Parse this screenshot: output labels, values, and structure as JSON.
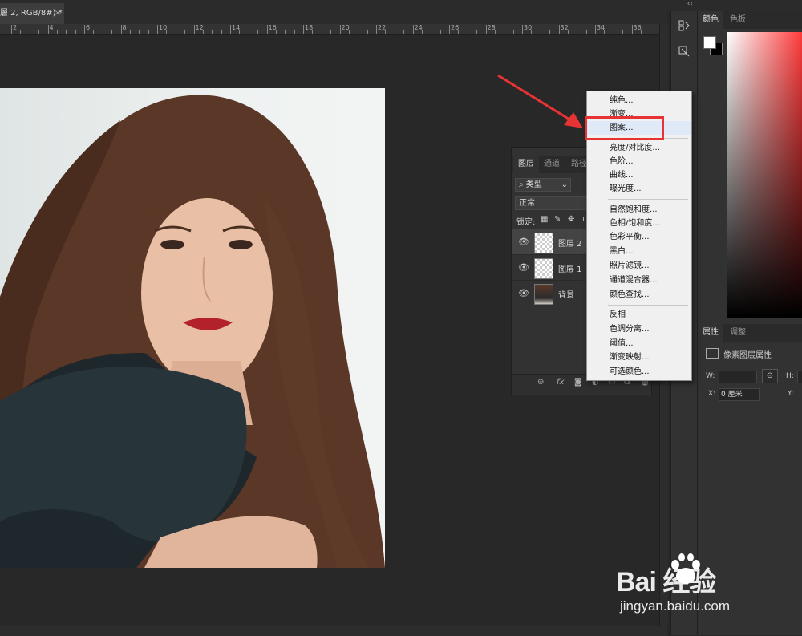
{
  "document": {
    "tab_title": "層 2, RGB/8#) *",
    "close_glyph": "×"
  },
  "ruler": {
    "labels": [
      "2",
      "4",
      "6",
      "8",
      "10",
      "12",
      "14",
      "16",
      "18",
      "20",
      "22",
      "24",
      "26",
      "28",
      "30",
      "32",
      "34",
      "36"
    ]
  },
  "right_panel": {
    "collapse_glyph": "‹‹",
    "color_tabs": [
      "颜色",
      "色板"
    ],
    "properties_tabs": [
      "属性",
      "调整"
    ],
    "properties_title": "像素图层属性",
    "w_label": "W:",
    "h_label": "H:",
    "x_label": "X:",
    "x_value": "0 厘米",
    "y_label": "Y:"
  },
  "layers_panel": {
    "tabs": [
      "图层",
      "通道",
      "路径"
    ],
    "filter_label": "类型",
    "blend_mode": "正常",
    "lock_label": "锁定:",
    "layers": [
      {
        "name": "图层 2",
        "active": true
      },
      {
        "name": "图层 1",
        "active": false
      },
      {
        "name": "背景",
        "active": false
      }
    ],
    "footer_icons": [
      "link-icon",
      "fx-icon",
      "mask-icon",
      "adjustment-icon",
      "folder-icon",
      "new-layer-icon",
      "trash-icon"
    ],
    "fx_label": "fx"
  },
  "menu": {
    "groups": [
      [
        "纯色...",
        "渐变...",
        "图案..."
      ],
      [
        "亮度/对比度...",
        "色阶...",
        "曲线...",
        "曝光度..."
      ],
      [
        "自然饱和度...",
        "色相/饱和度...",
        "色彩平衡...",
        "黑白...",
        "照片滤镜...",
        "通道混合器...",
        "颜色查找..."
      ],
      [
        "反相",
        "色调分离...",
        "阈值...",
        "渐变映射...",
        "可选颜色..."
      ]
    ],
    "highlighted": "图案..."
  },
  "annotation": {
    "color": "#e63333"
  },
  "watermark": {
    "brand": "Bai 经验",
    "url": "jingyan.baidu.com"
  }
}
